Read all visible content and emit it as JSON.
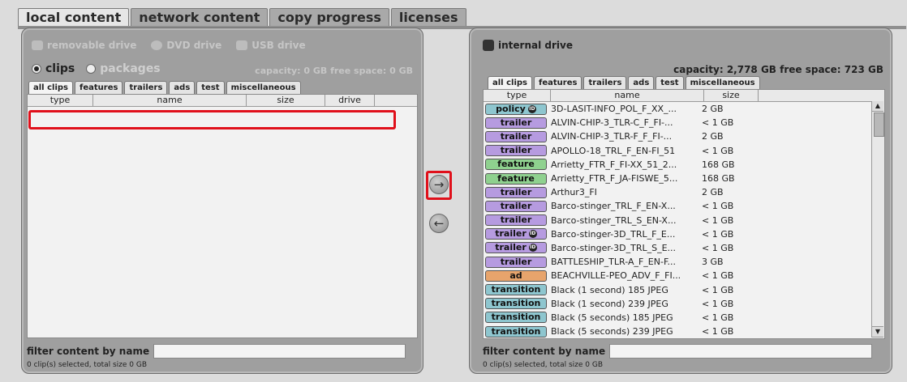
{
  "top_tabs": [
    "local content",
    "network content",
    "copy progress",
    "licenses"
  ],
  "left": {
    "drives": [
      "removable drive",
      "DVD drive",
      "USB drive"
    ],
    "mode_options": [
      "clips",
      "packages"
    ],
    "capacity_text": "capacity: 0 GB   free space: 0 GB",
    "tabs": [
      "all clips",
      "features",
      "trailers",
      "ads",
      "test",
      "miscellaneous"
    ],
    "columns": [
      "type",
      "name",
      "size",
      "drive"
    ],
    "filter_label": "filter content by name",
    "filter_value": "",
    "status": "0 clip(s) selected, total size 0 GB"
  },
  "right": {
    "title": "internal drive",
    "capacity_text": "capacity: 2,778 GB   free space: 723 GB",
    "tabs": [
      "all clips",
      "features",
      "trailers",
      "ads",
      "test",
      "miscellaneous"
    ],
    "columns": [
      "type",
      "name",
      "size"
    ],
    "rows": [
      {
        "type": "policy",
        "badge": "policy",
        "id": true,
        "name": "3D-LASIT-INFO_POL_F_XX_...",
        "size": "2 GB"
      },
      {
        "type": "trailer",
        "badge": "trailer",
        "id": false,
        "name": "ALVIN-CHIP-3_TLR-C_F_FI-...",
        "size": "< 1 GB"
      },
      {
        "type": "trailer",
        "badge": "trailer",
        "id": false,
        "name": "ALVIN-CHIP-3_TLR-F_F_FI-...",
        "size": "2 GB"
      },
      {
        "type": "trailer",
        "badge": "trailer",
        "id": false,
        "name": "APOLLO-18_TRL_F_EN-FI_51",
        "size": "< 1 GB"
      },
      {
        "type": "feature",
        "badge": "feature",
        "id": false,
        "name": "Arrietty_FTR_F_FI-XX_51_2...",
        "size": "168 GB"
      },
      {
        "type": "feature",
        "badge": "feature",
        "id": false,
        "name": "Arrietty_FTR_F_JA-FISWE_5...",
        "size": "168 GB"
      },
      {
        "type": "trailer",
        "badge": "trailer",
        "id": false,
        "name": "Arthur3_FI",
        "size": "2 GB"
      },
      {
        "type": "trailer",
        "badge": "trailer",
        "id": false,
        "name": "Barco-stinger_TRL_F_EN-X...",
        "size": "< 1 GB"
      },
      {
        "type": "trailer",
        "badge": "trailer",
        "id": false,
        "name": "Barco-stinger_TRL_S_EN-X...",
        "size": "< 1 GB"
      },
      {
        "type": "trailer",
        "badge": "trailer",
        "id": true,
        "name": "Barco-stinger-3D_TRL_F_E...",
        "size": "< 1 GB"
      },
      {
        "type": "trailer",
        "badge": "trailer",
        "id": true,
        "name": "Barco-stinger-3D_TRL_S_E...",
        "size": "< 1 GB"
      },
      {
        "type": "trailer",
        "badge": "trailer",
        "id": false,
        "name": "BATTLESHIP_TLR-A_F_EN-F...",
        "size": "3 GB"
      },
      {
        "type": "ad",
        "badge": "ad",
        "id": false,
        "name": "BEACHVILLE-PEO_ADV_F_FI...",
        "size": "< 1 GB"
      },
      {
        "type": "transition",
        "badge": "transition",
        "id": false,
        "name": "Black (1 second) 185 JPEG",
        "size": "< 1 GB"
      },
      {
        "type": "transition",
        "badge": "transition",
        "id": false,
        "name": "Black (1 second) 239 JPEG",
        "size": "< 1 GB"
      },
      {
        "type": "transition",
        "badge": "transition",
        "id": false,
        "name": "Black (5 seconds) 185 JPEG",
        "size": "< 1 GB"
      },
      {
        "type": "transition",
        "badge": "transition",
        "id": false,
        "name": "Black (5 seconds) 239 JPEG",
        "size": "< 1 GB"
      }
    ],
    "filter_label": "filter content by name",
    "filter_value": "",
    "status": "0 clip(s) selected, total size 0 GB"
  },
  "transfer": {
    "copy_right_symbol": "→",
    "copy_left_symbol": "←",
    "id_mark": "ID"
  },
  "colors": {
    "highlight": "#e0101b",
    "policy": "#8ec6cf",
    "trailer": "#b69be0",
    "feature": "#8fd18f",
    "ad": "#e7a46c",
    "transition": "#8ec6cf"
  }
}
